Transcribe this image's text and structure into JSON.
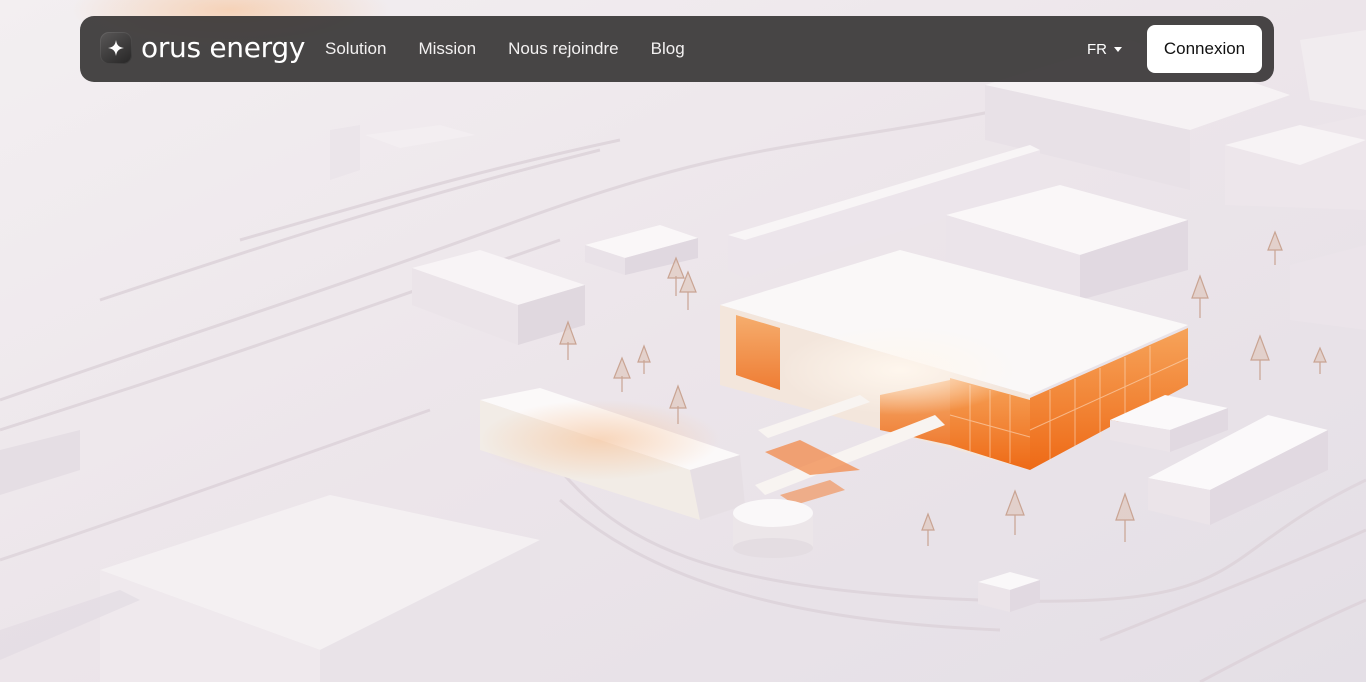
{
  "brand": {
    "name": "orus energy",
    "logo_icon": "sparkle-icon"
  },
  "nav": {
    "links": [
      {
        "label": "Solution"
      },
      {
        "label": "Mission"
      },
      {
        "label": "Nous rejoindre"
      },
      {
        "label": "Blog"
      }
    ],
    "language": {
      "value": "FR",
      "icon": "chevron-down-icon"
    },
    "login_label": "Connexion"
  },
  "hero_image": {
    "alt": "Isometric architectural model of a white industrial campus with an orange-glazed building",
    "accent_color": "#f07a22",
    "background_color": "#efe9ec"
  }
}
